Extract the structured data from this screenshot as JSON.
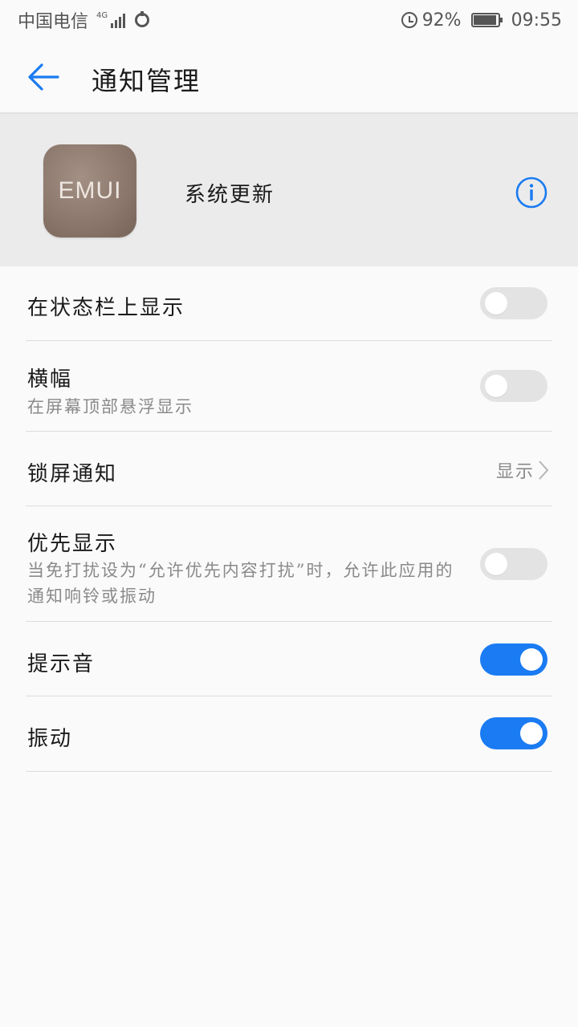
{
  "status_bar": {
    "carrier": "中国电信",
    "network": "4G",
    "battery": "92%",
    "battery_level": 0.92,
    "time": "09:55"
  },
  "app_bar": {
    "title": "通知管理"
  },
  "app_header": {
    "icon_text": "EMUI",
    "app_name": "系统更新"
  },
  "settings": {
    "status_bar_display": {
      "title": "在状态栏上显示",
      "enabled": false
    },
    "banner": {
      "title": "横幅",
      "subtitle": "在屏幕顶部悬浮显示",
      "enabled": false
    },
    "lock_screen": {
      "title": "锁屏通知",
      "value": "显示"
    },
    "priority": {
      "title": "优先显示",
      "subtitle": "当免打扰设为“允许优先内容打扰”时，允许此应用的通知响铃或振动",
      "enabled": false
    },
    "sound": {
      "title": "提示音",
      "enabled": true
    },
    "vibration": {
      "title": "振动",
      "enabled": true
    }
  },
  "colors": {
    "accent": "#1a7bf2",
    "toggle_off": "#e3e3e3",
    "header_bg": "#ebebeb",
    "page_bg": "#fafafa"
  },
  "icons": {
    "back": "arrow-left-icon",
    "info": "info-circle-icon",
    "chevron": "chevron-right-icon",
    "alarm": "alarm-clock-icon",
    "battery": "battery-icon",
    "signal": "signal-icon",
    "dnd": "do-not-disturb-icon"
  }
}
